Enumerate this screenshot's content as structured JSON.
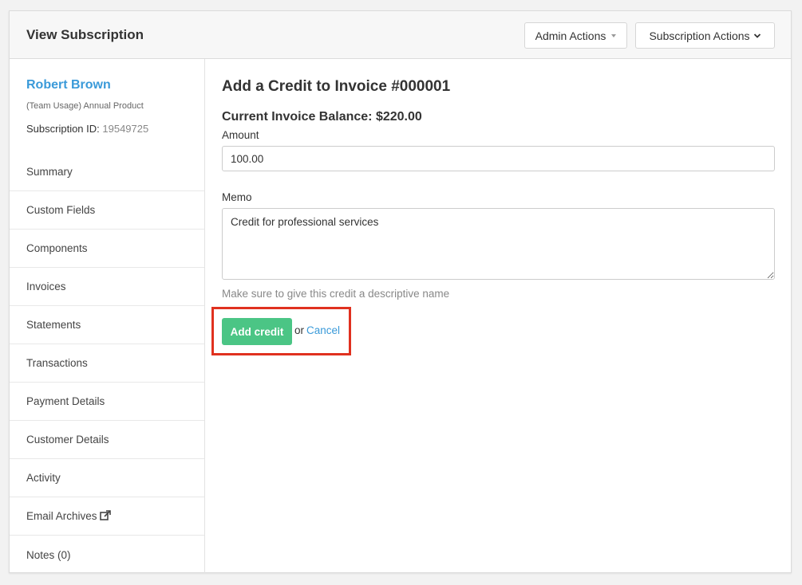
{
  "header": {
    "title": "View Subscription",
    "admin_actions_label": "Admin Actions",
    "subscription_actions_label": "Subscription Actions"
  },
  "sidebar": {
    "customer_name": "Robert Brown",
    "product": "(Team Usage) Annual Product",
    "subscription_id_label": "Subscription ID:",
    "subscription_id": "19549725",
    "items": [
      {
        "label": "Summary"
      },
      {
        "label": "Custom Fields"
      },
      {
        "label": "Components"
      },
      {
        "label": "Invoices"
      },
      {
        "label": "Statements"
      },
      {
        "label": "Transactions"
      },
      {
        "label": "Payment Details"
      },
      {
        "label": "Customer Details"
      },
      {
        "label": "Activity"
      },
      {
        "label": "Email Archives",
        "icon": "external-link-icon"
      },
      {
        "label": "Notes (0)"
      }
    ]
  },
  "form": {
    "title": "Add a Credit to Invoice #000001",
    "balance": "Current Invoice Balance: $220.00",
    "amount_label": "Amount",
    "amount_value": "100.00",
    "memo_label": "Memo",
    "memo_value": "Credit for professional services",
    "help_text": "Make sure to give this credit a descriptive name",
    "submit_label": "Add credit",
    "or_text": "or",
    "cancel_label": "Cancel"
  },
  "colors": {
    "link": "#3a9ad9",
    "submit": "#4bc585",
    "highlight": "#e0311f"
  }
}
